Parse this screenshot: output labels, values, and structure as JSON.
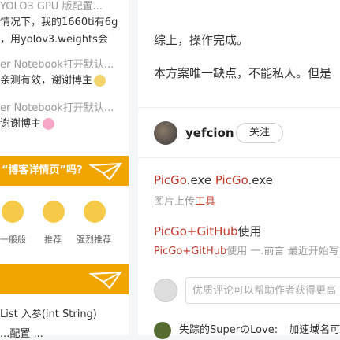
{
  "comments": [
    {
      "head": "YOLO3 GPU 版配置...",
      "text": "情况下，我的1660ti有6g",
      "text2": "，用yolov3.weights会"
    },
    {
      "head": "er Notebook打开默认...",
      "text": "亲测有效，谢谢博主"
    },
    {
      "head": "er Notebook打开默认...",
      "text": "谢谢博主"
    }
  ],
  "banner_top": "“博客详情页”吗?",
  "ratings": [
    "一般般",
    "推荐",
    "强烈推荐"
  ],
  "banner_bottom": "",
  "list_items": [
    "List 入参(int String)",
    "...配置 ..."
  ],
  "article": {
    "para1": "综上，操作完成。",
    "para2": "本方案唯一缺点，不能私人。但是"
  },
  "author": {
    "name": "yefcion",
    "follow": "关注"
  },
  "related": [
    {
      "title_parts": [
        "PicGo",
        ".exe ",
        "PicGo",
        ".exe"
      ],
      "sub_parts": [
        "图片上传",
        "工具"
      ]
    },
    {
      "title_parts": [
        "PicGo+GitHub",
        "使用"
      ],
      "sub_parts": [
        "PicGo+GitHub",
        "使用 一.前言 最近开始写"
      ]
    }
  ],
  "comment_input": {
    "placeholder": "优质评论可以帮助作者获得更高"
  },
  "last_comment": {
    "user": "失踪的SuperのLove:",
    "text": "加速域名可"
  }
}
